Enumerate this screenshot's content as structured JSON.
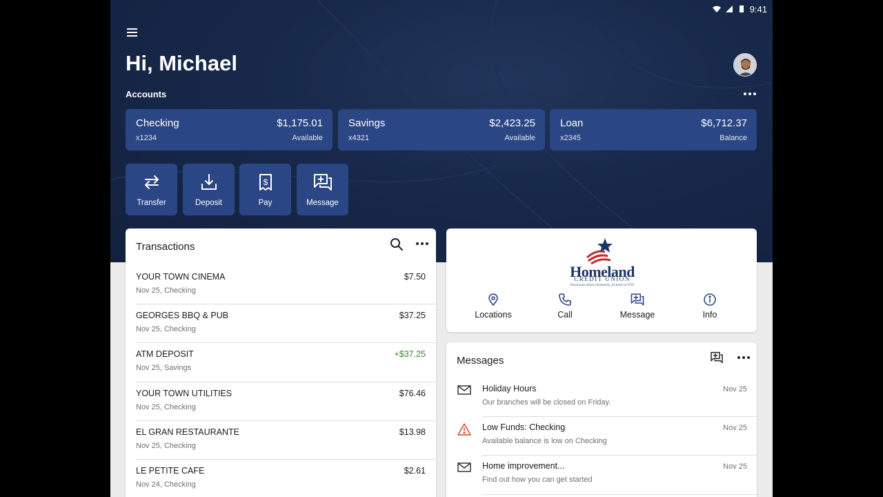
{
  "status_bar": {
    "time": "9:41",
    "icons": [
      "wifi-icon",
      "signal-icon",
      "battery-icon"
    ]
  },
  "header": {
    "greeting": "Hi, Michael",
    "accounts_label": "Accounts"
  },
  "accounts": [
    {
      "name": "Checking",
      "amount": "$1,175.01",
      "number": "x1234",
      "status": "Available"
    },
    {
      "name": "Savings",
      "amount": "$2,423.25",
      "number": "x4321",
      "status": "Available"
    },
    {
      "name": "Loan",
      "amount": "$6,712.37",
      "number": "x2345",
      "status": "Balance"
    }
  ],
  "actions": [
    {
      "label": "Transfer",
      "icon": "transfer-icon"
    },
    {
      "label": "Deposit",
      "icon": "deposit-icon"
    },
    {
      "label": "Pay",
      "icon": "pay-icon"
    },
    {
      "label": "Message",
      "icon": "message-icon"
    }
  ],
  "transactions": {
    "title": "Transactions",
    "items": [
      {
        "merchant": "YOUR TOWN CINEMA",
        "meta": "Nov 25, Checking",
        "amount": "$7.50",
        "credit": false
      },
      {
        "merchant": "GEORGES BBQ & PUB",
        "meta": "Nov 25, Checking",
        "amount": "$37.25",
        "credit": false
      },
      {
        "merchant": "ATM DEPOSIT",
        "meta": "Nov 25, Savings",
        "amount": "+$37.25",
        "credit": true
      },
      {
        "merchant": "YOUR TOWN UTILITIES",
        "meta": "Nov 25, Checking",
        "amount": "$76.46",
        "credit": false
      },
      {
        "merchant": "EL GRAN RESTAURANTE",
        "meta": "Nov 25, Checking",
        "amount": "$13.98",
        "credit": false
      },
      {
        "merchant": "LE PETITE CAFE",
        "meta": "Nov 24, Checking",
        "amount": "$2.61",
        "credit": false
      }
    ]
  },
  "credit_union": {
    "logo_name": "Homeland",
    "logo_sub": "CREDIT UNION",
    "logo_tagline": "Passionate about community, focused on YOU",
    "buttons": [
      {
        "label": "Locations",
        "icon": "location-pin-icon"
      },
      {
        "label": "Call",
        "icon": "phone-icon"
      },
      {
        "label": "Message",
        "icon": "message-icon"
      },
      {
        "label": "Info",
        "icon": "info-icon"
      }
    ]
  },
  "messages": {
    "title": "Messages",
    "items": [
      {
        "subject": "Holiday Hours",
        "preview": "Our branches will be closed on Friday.",
        "date": "Nov 25",
        "icon": "envelope-icon"
      },
      {
        "subject": "Low Funds: Checking",
        "preview": "Available balance is low on Checking",
        "date": "Nov 25",
        "icon": "warning-icon"
      },
      {
        "subject": "Home improvement...",
        "preview": "Find out how you can get started",
        "date": "Nov 25",
        "icon": "envelope-icon"
      }
    ]
  },
  "colors": {
    "hero_bg": "#17284a",
    "card_blue": "#2b4684",
    "credit_green": "#3b8a2e",
    "warning_red": "#d24a2a",
    "logo_navy": "#1d3566"
  }
}
